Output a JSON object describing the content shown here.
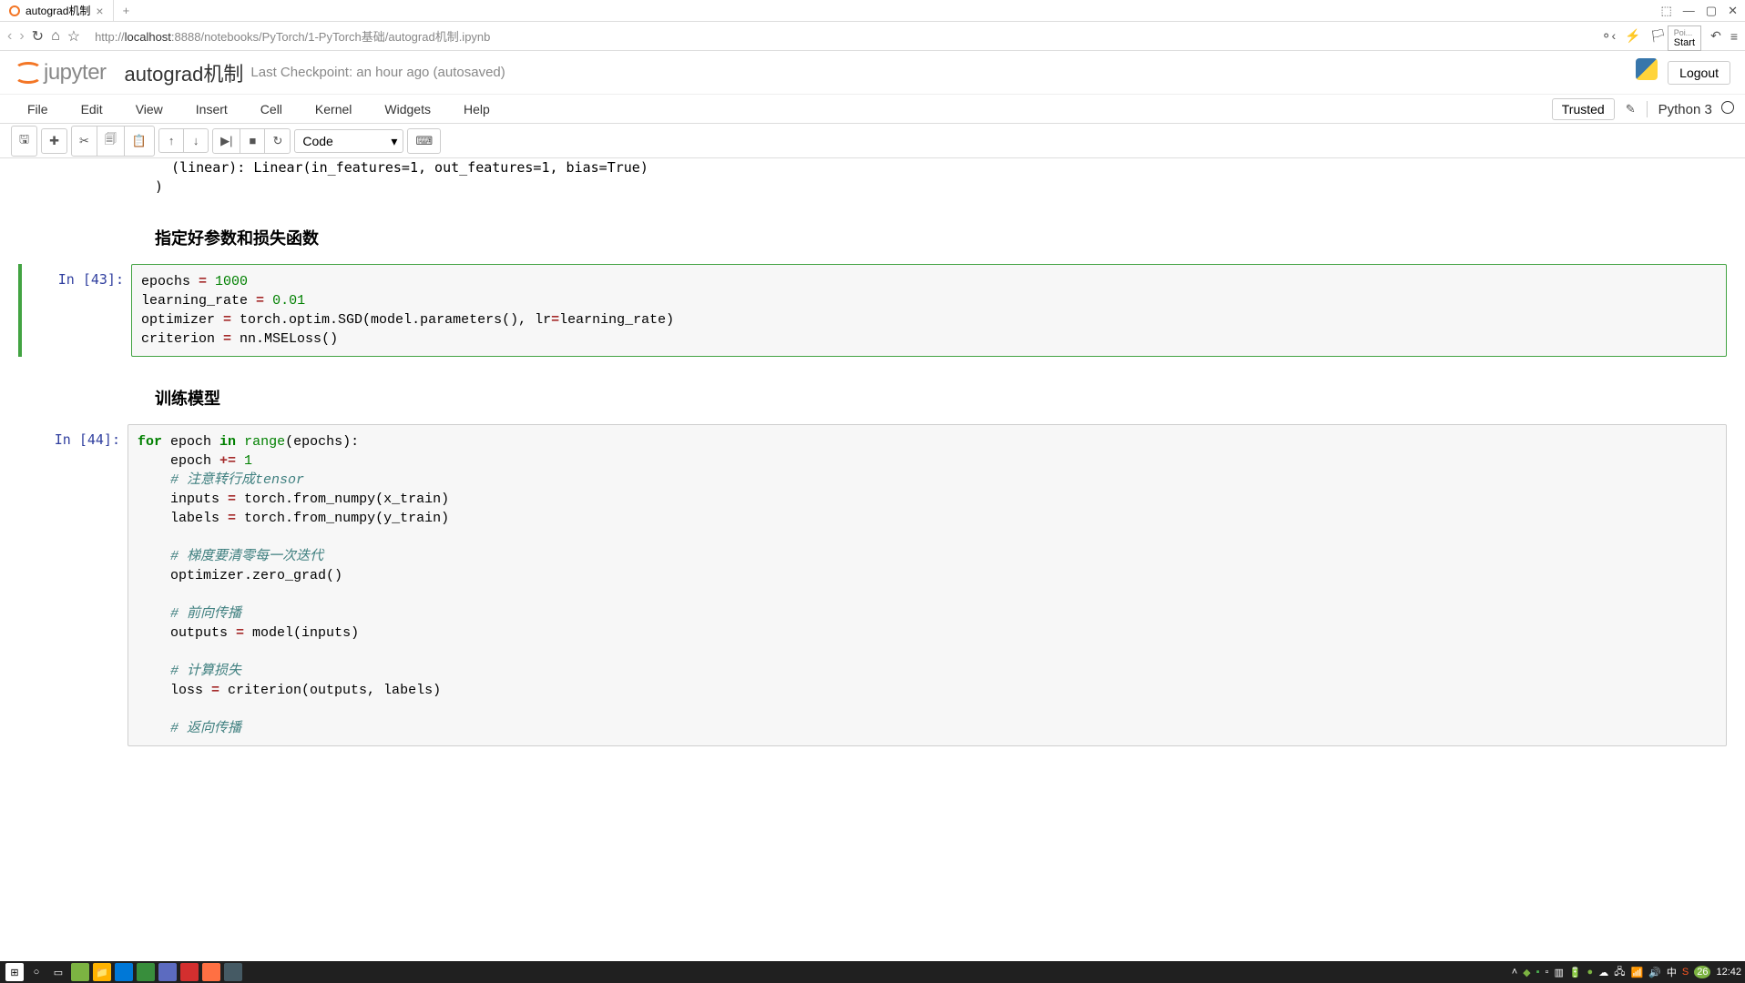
{
  "browser": {
    "tab_title": "autograd机制",
    "url_scheme": "http://",
    "url_host": "localhost",
    "url_path": ":8888/notebooks/PyTorch/1-PyTorch基础/autograd机制.ipynb",
    "start_button": "Start",
    "poi_label": "Poi..."
  },
  "header": {
    "logo_text": "jupyter",
    "notebook_name": "autograd机制",
    "checkpoint": "Last Checkpoint: an hour ago (autosaved)",
    "logout": "Logout"
  },
  "menubar": {
    "items": [
      "File",
      "Edit",
      "View",
      "Insert",
      "Cell",
      "Kernel",
      "Widgets",
      "Help"
    ],
    "trusted": "Trusted",
    "kernel": "Python 3"
  },
  "toolbar": {
    "cell_type": "Code"
  },
  "notebook": {
    "output_top": "  (linear): Linear(in_features=1, out_features=1, bias=True)\n)",
    "heading1": "指定好参数和损失函数",
    "cell1": {
      "prompt": "In [43]:",
      "tokens": [
        {
          "t": "epochs ",
          "c": ""
        },
        {
          "t": "=",
          "c": "op"
        },
        {
          "t": " ",
          "c": ""
        },
        {
          "t": "1000",
          "c": "num"
        },
        {
          "t": "\n",
          "c": ""
        },
        {
          "t": "learning_rate ",
          "c": ""
        },
        {
          "t": "=",
          "c": "op"
        },
        {
          "t": " ",
          "c": ""
        },
        {
          "t": "0.01",
          "c": "num"
        },
        {
          "t": "\n",
          "c": ""
        },
        {
          "t": "optimizer ",
          "c": ""
        },
        {
          "t": "=",
          "c": "op"
        },
        {
          "t": " torch.optim.SGD(model.parameters(), lr",
          "c": ""
        },
        {
          "t": "=",
          "c": "op"
        },
        {
          "t": "learning_rate)\n",
          "c": ""
        },
        {
          "t": "criterion ",
          "c": ""
        },
        {
          "t": "=",
          "c": "op"
        },
        {
          "t": " nn.MSELoss",
          "c": ""
        },
        {
          "t": "()",
          "c": ""
        }
      ]
    },
    "heading2": "训练模型",
    "cell2": {
      "prompt": "In [44]:",
      "tokens": [
        {
          "t": "for",
          "c": "kw"
        },
        {
          "t": " epoch ",
          "c": ""
        },
        {
          "t": "in",
          "c": "kw"
        },
        {
          "t": " ",
          "c": ""
        },
        {
          "t": "range",
          "c": "builtin"
        },
        {
          "t": "(epochs):\n",
          "c": ""
        },
        {
          "t": "    epoch ",
          "c": ""
        },
        {
          "t": "+=",
          "c": "op"
        },
        {
          "t": " ",
          "c": ""
        },
        {
          "t": "1",
          "c": "num"
        },
        {
          "t": "\n",
          "c": ""
        },
        {
          "t": "    # 注意转行成tensor",
          "c": "comment"
        },
        {
          "t": "\n",
          "c": ""
        },
        {
          "t": "    inputs ",
          "c": ""
        },
        {
          "t": "=",
          "c": "op"
        },
        {
          "t": " torch.from_numpy(x_train)\n",
          "c": ""
        },
        {
          "t": "    labels ",
          "c": ""
        },
        {
          "t": "=",
          "c": "op"
        },
        {
          "t": " torch.from_numpy(y_train)\n",
          "c": ""
        },
        {
          "t": "\n",
          "c": ""
        },
        {
          "t": "    # 梯度要清零每一次迭代",
          "c": "comment"
        },
        {
          "t": "\n",
          "c": ""
        },
        {
          "t": "    optimizer.zero_grad()\n",
          "c": ""
        },
        {
          "t": "\n",
          "c": ""
        },
        {
          "t": "    # 前向传播",
          "c": "comment"
        },
        {
          "t": "\n",
          "c": ""
        },
        {
          "t": "    outputs ",
          "c": ""
        },
        {
          "t": "=",
          "c": "op"
        },
        {
          "t": " model(inputs)\n",
          "c": ""
        },
        {
          "t": "\n",
          "c": ""
        },
        {
          "t": "    # 计算损失",
          "c": "comment"
        },
        {
          "t": "\n",
          "c": ""
        },
        {
          "t": "    loss ",
          "c": ""
        },
        {
          "t": "=",
          "c": "op"
        },
        {
          "t": " criterion(outputs, labels)\n",
          "c": ""
        },
        {
          "t": "\n",
          "c": ""
        },
        {
          "t": "    # 返向传播",
          "c": "comment"
        }
      ]
    }
  },
  "taskbar": {
    "time": "12:42",
    "badge": "26"
  }
}
